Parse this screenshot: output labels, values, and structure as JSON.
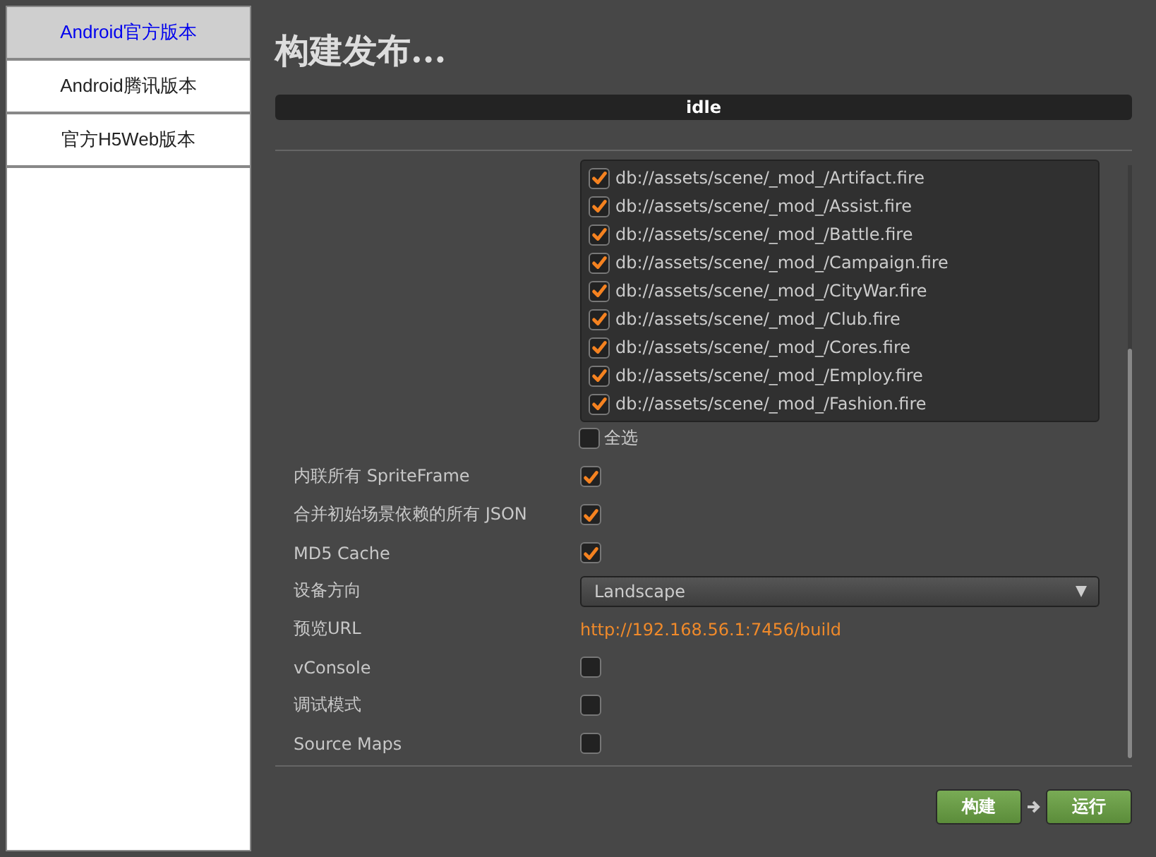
{
  "sidebar": {
    "items": [
      {
        "label": "Android官方版本",
        "selected": true
      },
      {
        "label": "Android腾讯版本",
        "selected": false
      },
      {
        "label": "官方H5Web版本",
        "selected": false
      }
    ]
  },
  "title": "构建发布...",
  "status": {
    "text": "idle"
  },
  "scenes": [
    {
      "path": "db://assets/scene/_mod_/Artifact.fire",
      "checked": true
    },
    {
      "path": "db://assets/scene/_mod_/Assist.fire",
      "checked": true
    },
    {
      "path": "db://assets/scene/_mod_/Battle.fire",
      "checked": true
    },
    {
      "path": "db://assets/scene/_mod_/Campaign.fire",
      "checked": true
    },
    {
      "path": "db://assets/scene/_mod_/CityWar.fire",
      "checked": true
    },
    {
      "path": "db://assets/scene/_mod_/Club.fire",
      "checked": true
    },
    {
      "path": "db://assets/scene/_mod_/Cores.fire",
      "checked": true
    },
    {
      "path": "db://assets/scene/_mod_/Employ.fire",
      "checked": true
    },
    {
      "path": "db://assets/scene/_mod_/Fashion.fire",
      "checked": true
    }
  ],
  "select_all": {
    "label": "全选",
    "checked": false
  },
  "settings": [
    {
      "kind": "checkbox",
      "label": "内联所有 SpriteFrame",
      "checked": true
    },
    {
      "kind": "checkbox",
      "label": "合并初始场景依赖的所有 JSON",
      "checked": true
    },
    {
      "kind": "checkbox",
      "label": "MD5 Cache",
      "checked": true
    },
    {
      "kind": "select",
      "label": "设备方向",
      "value": "Landscape"
    },
    {
      "kind": "link",
      "label": "预览URL",
      "value": "http://192.168.56.1:7456/build"
    },
    {
      "kind": "checkbox",
      "label": "vConsole",
      "checked": false
    },
    {
      "kind": "checkbox",
      "label": "调试模式",
      "checked": false
    },
    {
      "kind": "checkbox",
      "label": "Source Maps",
      "checked": false
    }
  ],
  "buttons": [
    {
      "label": "构建"
    },
    {
      "label": "运行"
    }
  ]
}
